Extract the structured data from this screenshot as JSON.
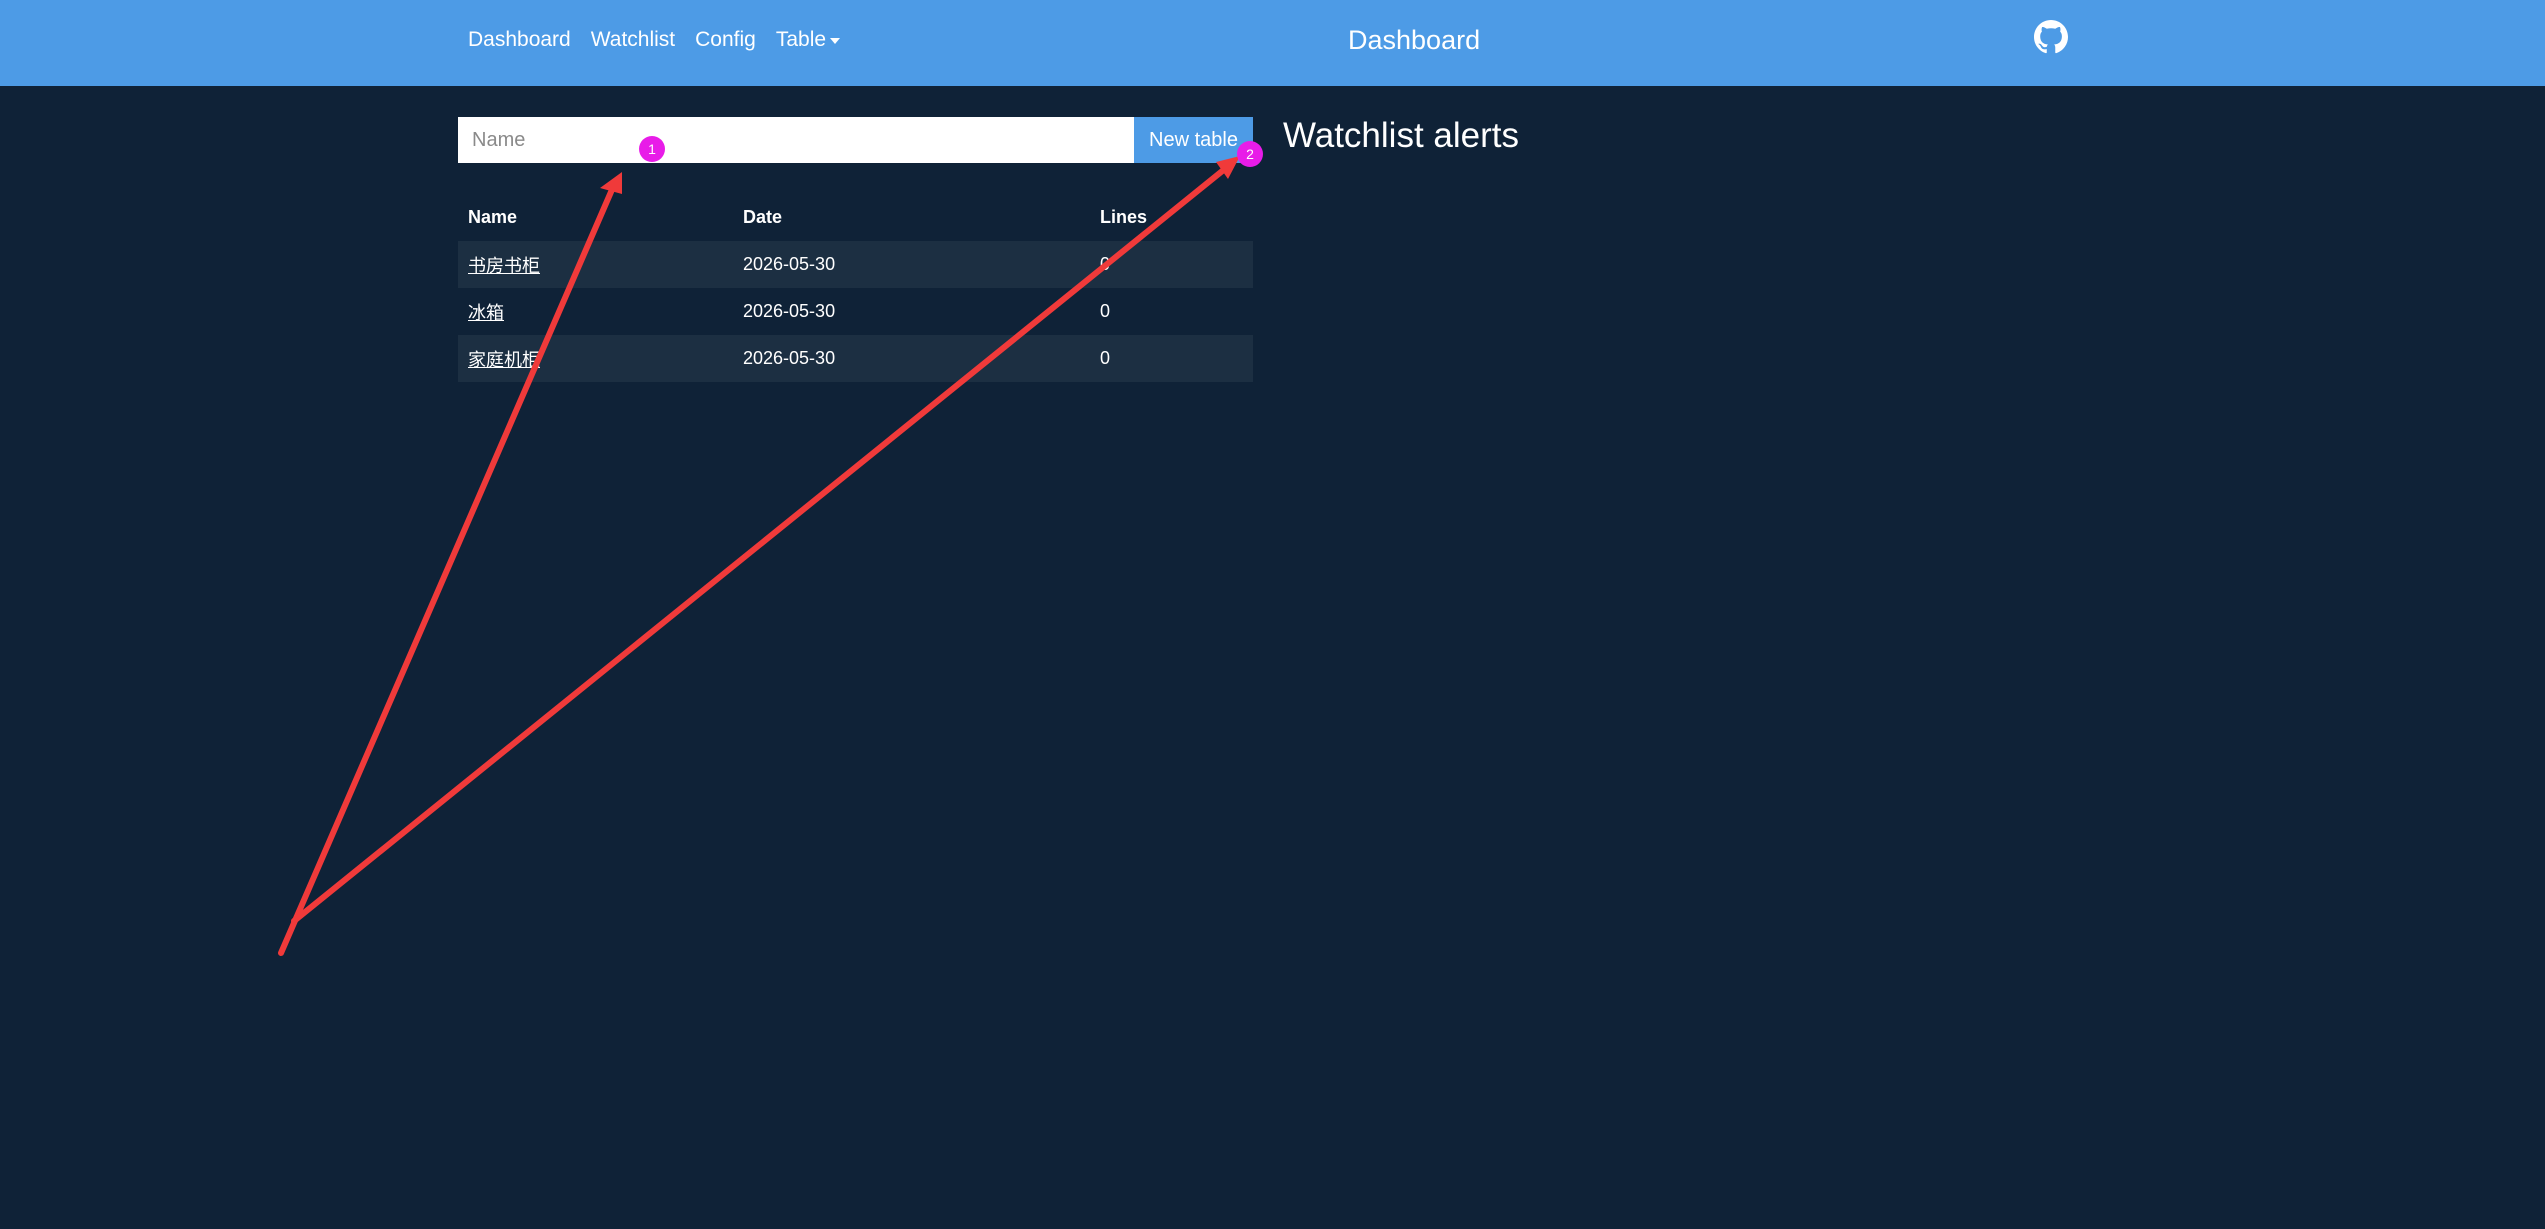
{
  "navbar": {
    "links": [
      {
        "label": "Dashboard"
      },
      {
        "label": "Watchlist"
      },
      {
        "label": "Config"
      }
    ],
    "dropdown_label": "Table",
    "title": "Dashboard",
    "github_icon": "github-icon"
  },
  "form": {
    "name_placeholder": "Name",
    "name_value": "",
    "button_label": "New table"
  },
  "tables": {
    "headers": {
      "name": "Name",
      "date": "Date",
      "lines": "Lines"
    },
    "rows": [
      {
        "name": "书房书柜",
        "date": "2026-05-30",
        "lines": "0"
      },
      {
        "name": "冰箱",
        "date": "2026-05-30",
        "lines": "0"
      },
      {
        "name": "家庭机柜",
        "date": "2026-05-30",
        "lines": "0"
      }
    ]
  },
  "watchlist": {
    "heading": "Watchlist alerts"
  },
  "annotations": {
    "arrow_color": "#f03a3a",
    "marker_color": "#e81ce8",
    "markers": [
      {
        "label": "1"
      },
      {
        "label": "2"
      }
    ]
  }
}
